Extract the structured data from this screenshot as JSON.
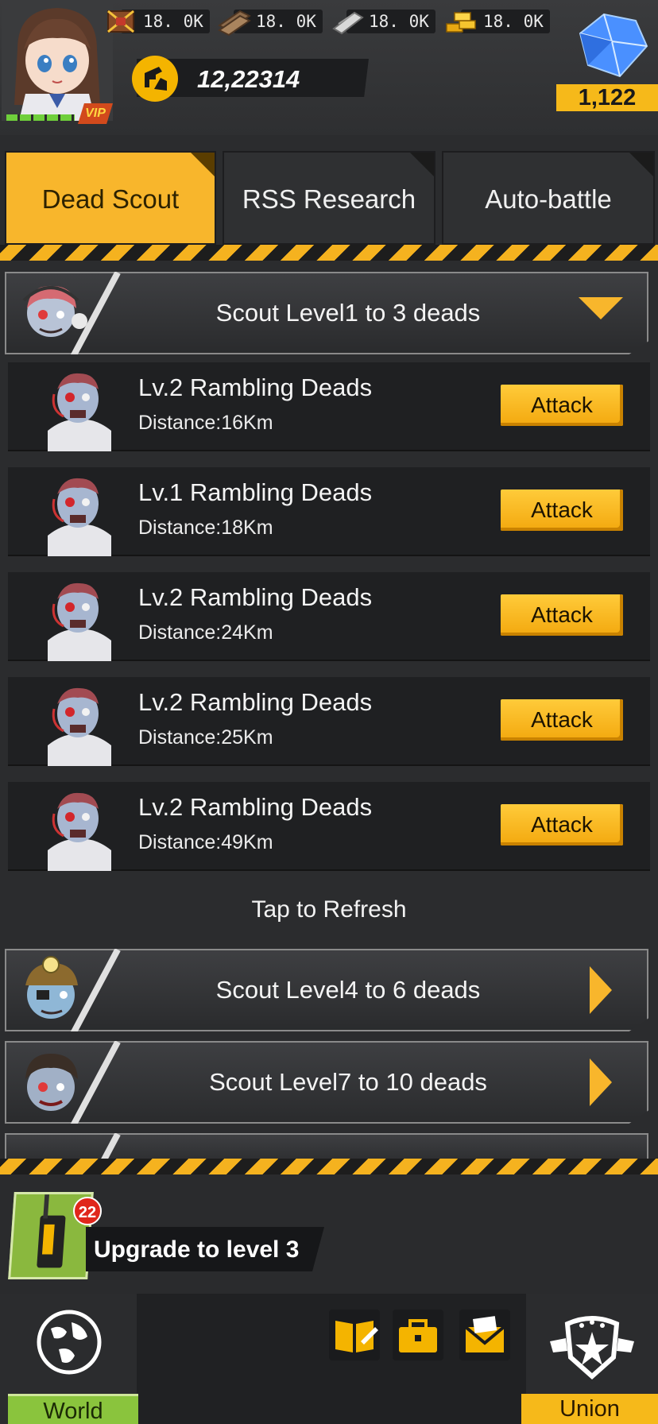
{
  "player": {
    "vip_label": "VIP"
  },
  "resources": [
    {
      "icon": "food-crate-icon",
      "value": "18. 0K"
    },
    {
      "icon": "wood-planks-icon",
      "value": "18. 0K"
    },
    {
      "icon": "steel-bars-icon",
      "value": "18. 0K"
    },
    {
      "icon": "gold-bars-icon",
      "value": "18. 0K"
    }
  ],
  "power": {
    "icon": "power-icon",
    "value": "12,22314"
  },
  "gems": {
    "icon": "crystal-icon",
    "value": "1,122"
  },
  "tabs": [
    {
      "label": "Dead Scout",
      "active": true
    },
    {
      "label": "RSS Research",
      "active": false
    },
    {
      "label": "Auto-battle",
      "active": false
    }
  ],
  "sections": [
    {
      "label": "Scout Level1 to 3 deads",
      "expanded": true
    },
    {
      "label": "Scout Level4 to 6 deads",
      "expanded": false
    },
    {
      "label": "Scout Level7 to 10 deads",
      "expanded": false
    }
  ],
  "targets": [
    {
      "name": "Lv.2 Rambling Deads",
      "distance": "Distance:16Km",
      "button": "Attack"
    },
    {
      "name": "Lv.1 Rambling Deads",
      "distance": "Distance:18Km",
      "button": "Attack"
    },
    {
      "name": "Lv.2 Rambling Deads",
      "distance": "Distance:24Km",
      "button": "Attack"
    },
    {
      "name": "Lv.2 Rambling Deads",
      "distance": "Distance:25Km",
      "button": "Attack"
    },
    {
      "name": "Lv.2 Rambling Deads",
      "distance": "Distance:49Km",
      "button": "Attack"
    }
  ],
  "refresh_label": "Tap to Refresh",
  "quest": {
    "badge": "22",
    "text": "Upgrade to level 3"
  },
  "nav": {
    "world_label": "World",
    "union_label": "Union",
    "tools": [
      "journal-icon",
      "toolbox-icon",
      "mail-icon"
    ]
  },
  "colors": {
    "accent": "#f8b62c",
    "background": "#2b2c2e",
    "row_bg": "#1f2022",
    "world_green": "#8ac43d"
  }
}
